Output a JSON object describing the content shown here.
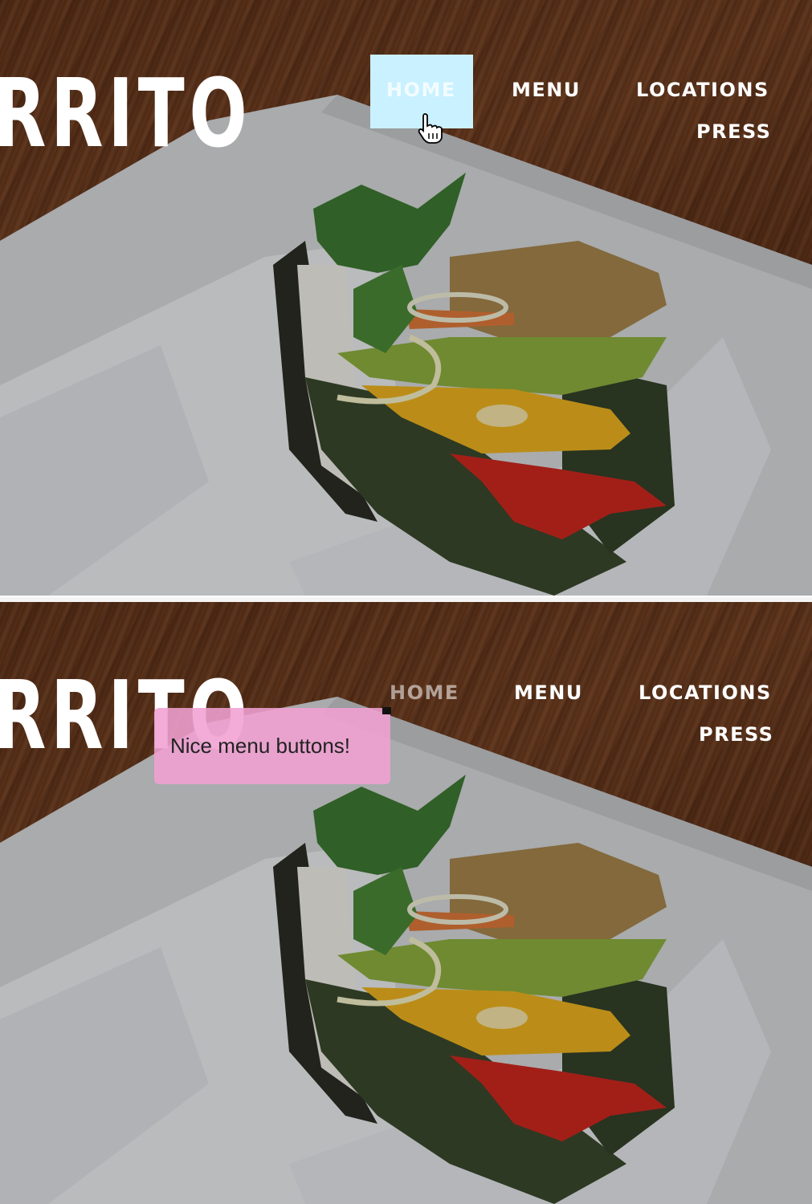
{
  "panels": [
    {
      "logo_text": "RRITO",
      "nav": {
        "home": "HOME",
        "menu": "MENU",
        "locations": "LOCATIONS",
        "press": "PRESS"
      },
      "state": "home-hover"
    },
    {
      "logo_text": "RRITO",
      "nav": {
        "home": "HOME",
        "menu": "MENU",
        "locations": "LOCATIONS",
        "press": "PRESS"
      },
      "state": "comment",
      "comment": {
        "text": "Nice menu buttons!",
        "color": "#f0a0d2"
      }
    }
  ],
  "colors": {
    "hover_highlight": "#c9f1ff",
    "nav_text": "#ffffff"
  },
  "icons": {
    "cursor": "hand-pointer-icon"
  }
}
